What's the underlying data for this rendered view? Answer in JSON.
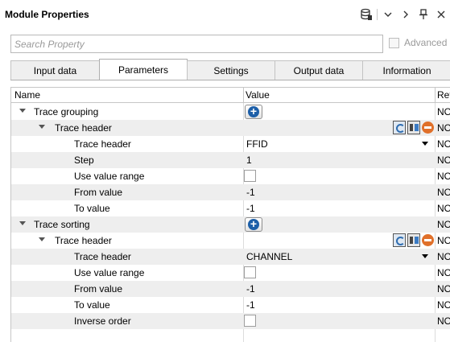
{
  "window": {
    "title": "Module Properties",
    "icons": [
      "database-icon",
      "chevron-down-icon",
      "chevron-right-icon",
      "pin-icon",
      "close-icon"
    ]
  },
  "search": {
    "placeholder": "Search Property",
    "advanced_label": "Advanced"
  },
  "tabs": [
    {
      "label": "Input data",
      "active": false
    },
    {
      "label": "Parameters",
      "active": true
    },
    {
      "label": "Settings",
      "active": false
    },
    {
      "label": "Output data",
      "active": false
    },
    {
      "label": "Information",
      "active": false
    }
  ],
  "grid": {
    "columns": {
      "name": "Name",
      "value": "Value",
      "ref": "Ref"
    },
    "rows": [
      {
        "name": "Trace grouping",
        "value": "",
        "ref": "NO"
      },
      {
        "name": "Trace header",
        "value": "",
        "ref": "NO"
      },
      {
        "name": "Trace header",
        "value": "FFID",
        "ref": "NO"
      },
      {
        "name": "Step",
        "value": "1",
        "ref": "NO"
      },
      {
        "name": "Use value range",
        "value": "",
        "ref": "NO"
      },
      {
        "name": "From value",
        "value": "-1",
        "ref": "NO"
      },
      {
        "name": "To value",
        "value": "-1",
        "ref": "NO"
      },
      {
        "name": "Trace sorting",
        "value": "",
        "ref": "NO"
      },
      {
        "name": "Trace header",
        "value": "",
        "ref": "NO"
      },
      {
        "name": "Trace header",
        "value": "CHANNEL",
        "ref": "NO"
      },
      {
        "name": "Use value range",
        "value": "",
        "ref": "NO"
      },
      {
        "name": "From value",
        "value": "-1",
        "ref": "NO"
      },
      {
        "name": "To value",
        "value": "-1",
        "ref": "NO"
      },
      {
        "name": "Inverse order",
        "value": "",
        "ref": "NO"
      }
    ]
  }
}
